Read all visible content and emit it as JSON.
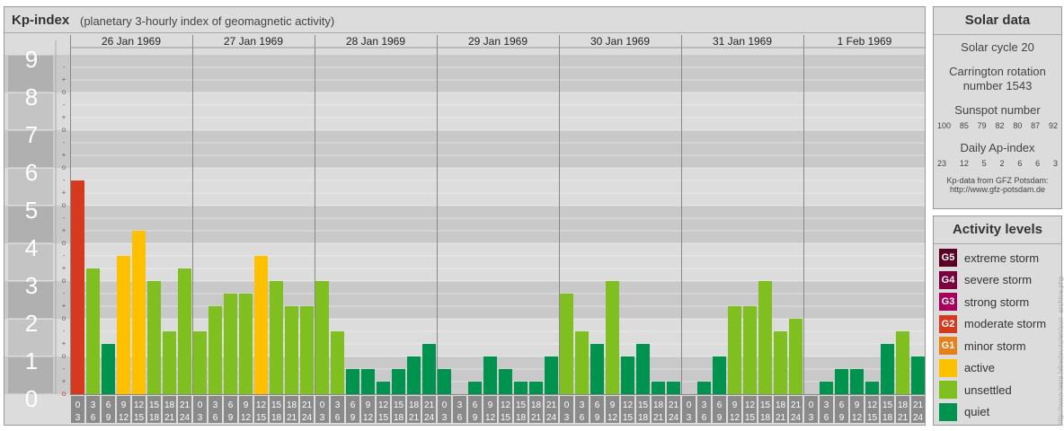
{
  "header": {
    "title": "Kp-index",
    "subtitle": "(planetary 3-hourly index of geomagnetic activity)"
  },
  "chart_data": {
    "type": "bar",
    "title": "Kp-index",
    "subtitle": "(planetary 3-hourly index of geomagnetic activity)",
    "ylim": [
      0,
      9
    ],
    "y_ticks": [
      "0",
      "1",
      "2",
      "3",
      "4",
      "5",
      "6",
      "7",
      "8",
      "9"
    ],
    "sub_ticks": [
      "-",
      "o",
      "+"
    ],
    "days": [
      "26 Jan 1969",
      "27 Jan 1969",
      "28 Jan 1969",
      "29 Jan 1969",
      "30 Jan 1969",
      "31 Jan 1969",
      "1 Feb 1969"
    ],
    "interval_starts": [
      "0",
      "3",
      "6",
      "9",
      "12",
      "15",
      "18",
      "21"
    ],
    "interval_ends": [
      "3",
      "6",
      "9",
      "12",
      "15",
      "18",
      "21",
      "24"
    ],
    "values": [
      [
        5.667,
        3.333,
        1.333,
        3.667,
        4.333,
        3.0,
        1.667,
        3.333
      ],
      [
        1.667,
        2.333,
        2.667,
        2.667,
        3.667,
        3.0,
        2.333,
        2.333
      ],
      [
        3.0,
        1.667,
        0.667,
        0.667,
        0.333,
        0.667,
        1.0,
        1.333
      ],
      [
        0.667,
        0.0,
        0.333,
        1.0,
        0.667,
        0.333,
        0.333,
        1.0
      ],
      [
        2.667,
        1.667,
        1.333,
        3.0,
        1.0,
        1.333,
        0.333,
        0.333
      ],
      [
        0.0,
        0.333,
        1.0,
        2.333,
        2.333,
        3.0,
        1.667,
        2.0
      ],
      [
        0.0,
        0.333,
        0.667,
        0.667,
        0.333,
        1.333,
        1.667,
        1.0
      ]
    ],
    "level_colors": {
      "G5": "#5a0024",
      "G4": "#7a0040",
      "G3": "#a8005a",
      "G2": "#d63a1e",
      "G1": "#e8801a",
      "active": "#ffc000",
      "unsettled": "#7fbf1f",
      "quiet": "#00924f"
    }
  },
  "solar": {
    "heading": "Solar data",
    "cycle": "Solar cycle 20",
    "carrington_line1": "Carrington rotation",
    "carrington_line2": "number 1543",
    "sunspot_heading": "Sunspot number",
    "sunspots": [
      "100",
      "85",
      "79",
      "82",
      "80",
      "87",
      "92"
    ],
    "ap_heading": "Daily Ap-index",
    "ap": [
      "23",
      "12",
      "5",
      "2",
      "6",
      "6",
      "3"
    ],
    "credit_line1": "Kp-data from GFZ Potsdam:",
    "credit_line2": "http://www.gfz-potsdam.de"
  },
  "activity": {
    "heading": "Activity levels",
    "items": [
      {
        "code": "G5",
        "label": "extreme storm",
        "color": "#5a0024"
      },
      {
        "code": "G4",
        "label": "severe storm",
        "color": "#7a0040"
      },
      {
        "code": "G3",
        "label": "strong storm",
        "color": "#a8005a"
      },
      {
        "code": "G2",
        "label": "moderate storm",
        "color": "#d63a1e"
      },
      {
        "code": "G1",
        "label": "minor storm",
        "color": "#e8801a"
      },
      {
        "code": "",
        "label": "active",
        "color": "#ffc000"
      },
      {
        "code": "",
        "label": "unsettled",
        "color": "#7fbf1f"
      },
      {
        "code": "",
        "label": "quiet",
        "color": "#00924f"
      }
    ]
  },
  "watermark": "http://www.tesis.lebedev.ru/en/sun_archive.php"
}
